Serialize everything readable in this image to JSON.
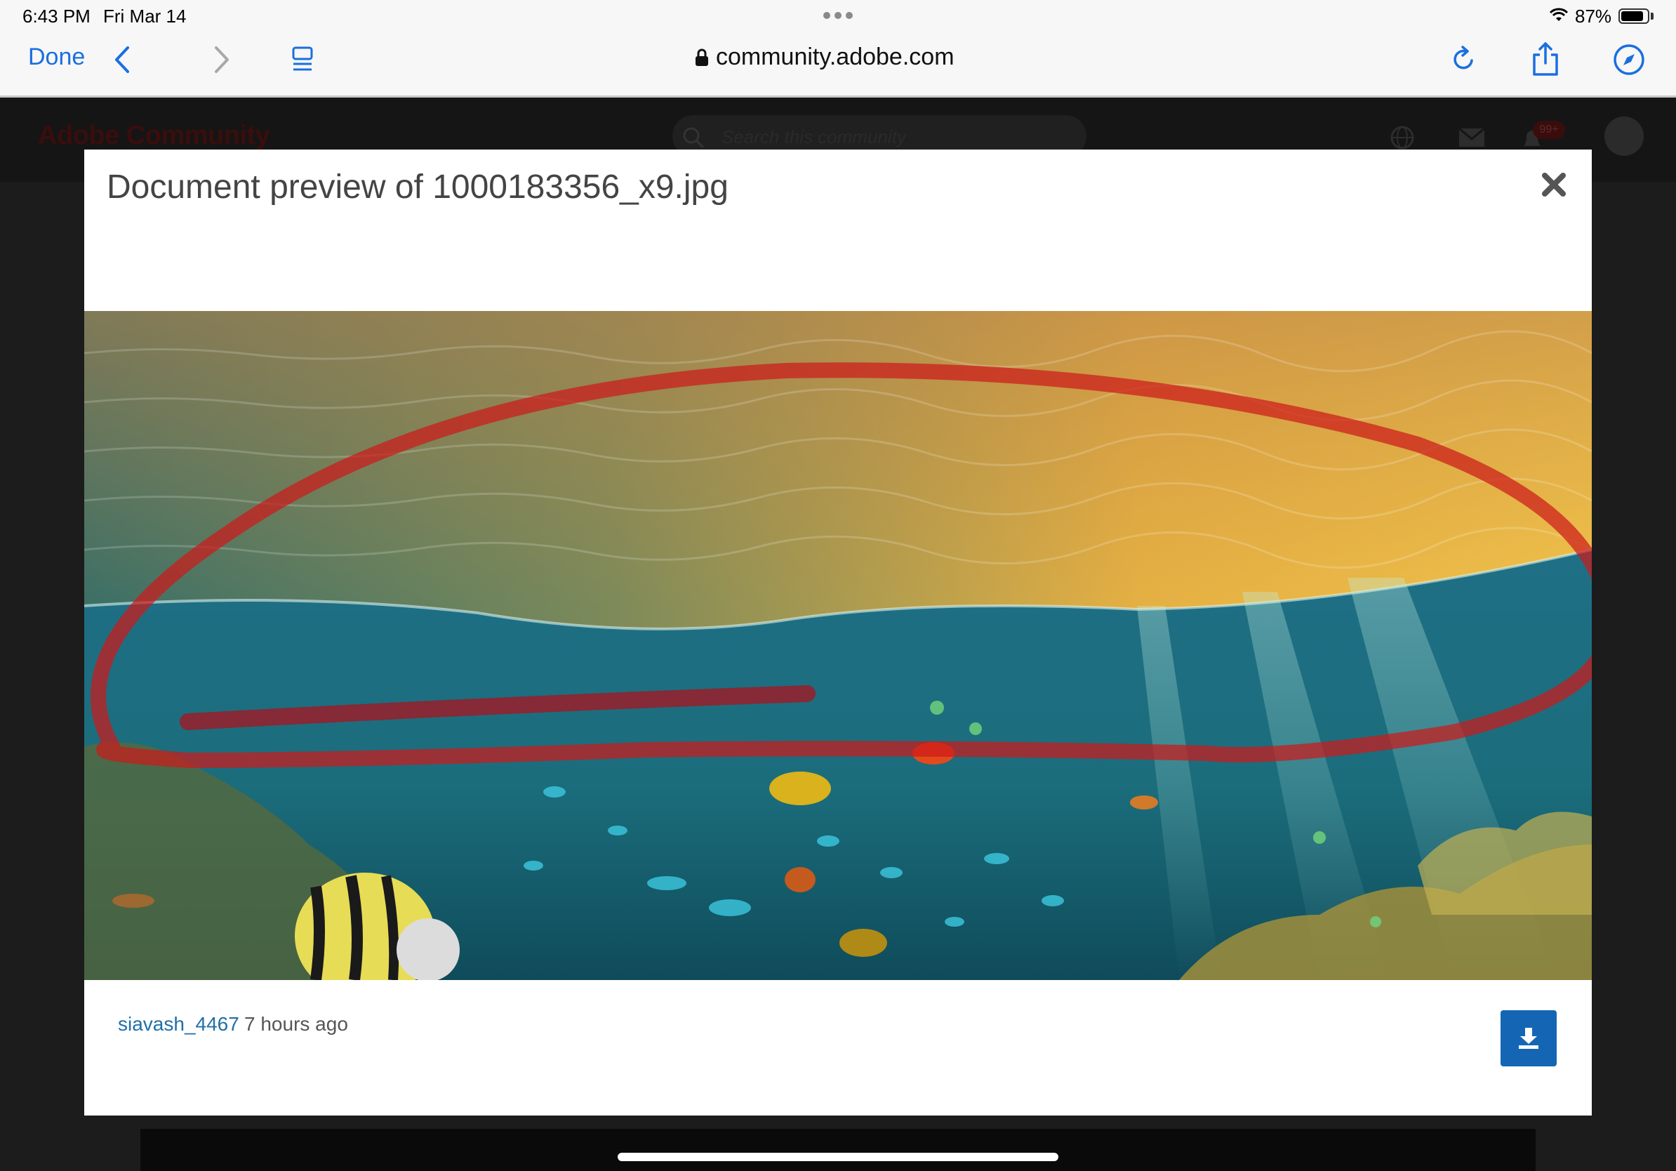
{
  "status_bar": {
    "time": "6:43 PM",
    "date": "Fri Mar 14",
    "battery": "87%"
  },
  "browser": {
    "done_label": "Done",
    "url": "community.adobe.com"
  },
  "background_page": {
    "brand": "Adobe Community",
    "search_placeholder": "Search this community",
    "notification_badge": "99+"
  },
  "modal": {
    "title": "Document preview of 1000183356_x9.jpg",
    "author": "siavash_4467",
    "posted": "7 hours ago"
  },
  "colors": {
    "accent": "#1a6fe0",
    "download_button": "#1466b4",
    "author_link": "#1f6fa8"
  }
}
